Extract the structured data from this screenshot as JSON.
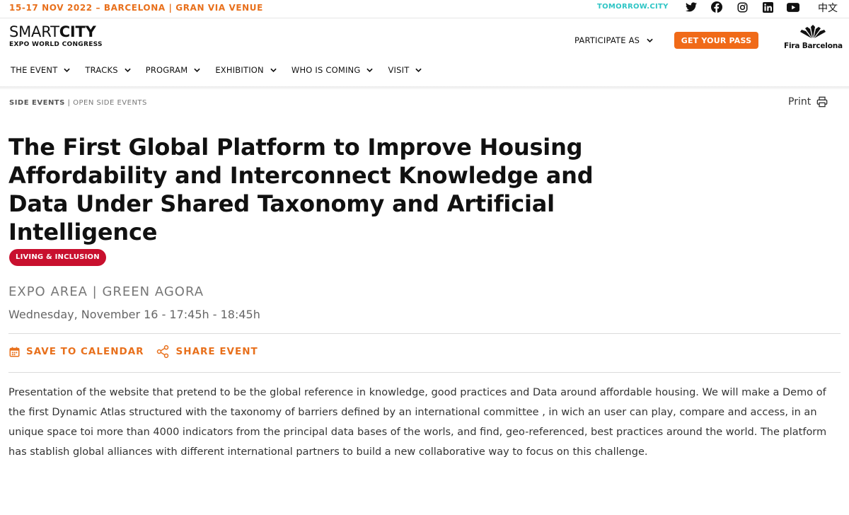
{
  "topbar": {
    "event_info": "15-17 NOV 2022 – BARCELONA | GRAN VIA VENUE",
    "tomorrow_link": "TOMORROW.CITY",
    "social_icons": [
      "twitter-icon",
      "facebook-icon",
      "instagram-icon",
      "linkedin-icon",
      "youtube-icon"
    ],
    "language": "中文"
  },
  "header": {
    "logo_light": "SMART",
    "logo_bold": "CITY",
    "logo_sub": "EXPO WORLD CONGRESS",
    "participate_label": "PARTICIPATE AS",
    "pass_button": "GET YOUR PASS",
    "partner_logo": "Fira Barcelona"
  },
  "nav": {
    "items": [
      {
        "label": "THE EVENT"
      },
      {
        "label": "TRACKS"
      },
      {
        "label": "PROGRAM"
      },
      {
        "label": "EXHIBITION"
      },
      {
        "label": "WHO IS COMING"
      },
      {
        "label": "VISIT"
      }
    ]
  },
  "breadcrumb": {
    "section": "SIDE EVENTS",
    "separator": "|",
    "current": "OPEN SIDE EVENTS"
  },
  "print_label": "Print",
  "event": {
    "title": "The First Global Platform to Improve Housing Affordability and Interconnect Knowledge and Data Under Shared Taxonomy and Artificial Intelligence",
    "tag": "LIVING & INCLUSION",
    "location": "EXPO AREA | GREEN AGORA",
    "datetime": "Wednesday, November 16 - 17:45h - 18:45h",
    "save_label": "SAVE TO CALENDAR",
    "share_label": "SHARE EVENT",
    "description": "Presentation of the website that pretend to be the global reference in knowledge, good practices and Data around affordable housing. We will make a Demo of the first Dynamic Atlas structured with the taxonomy of barriers defined by an international committee , in wich an user can play, compare and access, in an unique space toi more than 4000 indicators from the principal data bases of the worls, and find, geo-referenced, best practices around the world. The platform has stablish global alliances with different international partners to build a new collaborative way to focus on this challenge."
  },
  "colors": {
    "accent_orange": "#f06a18",
    "tag_red": "#c8102e",
    "tomorrow_teal": "#2ec5c5"
  }
}
